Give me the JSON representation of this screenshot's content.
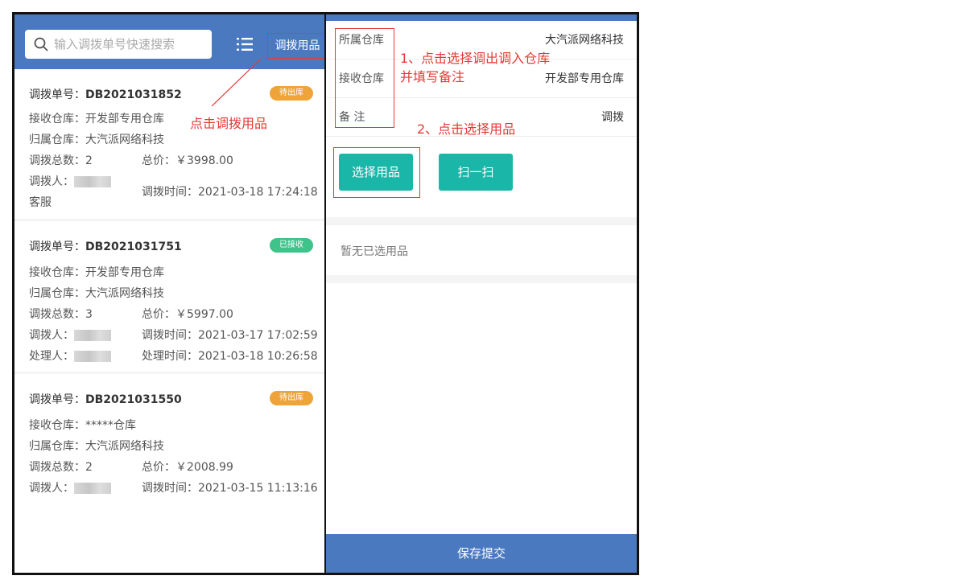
{
  "left": {
    "search_placeholder": "输入调拨单号快速搜索",
    "top_link": "调拨用品",
    "orders": [
      {
        "id_label": "调拨单号：",
        "id": "DB2021031852",
        "status": "待出库",
        "receive": "接收仓库：开发部专用仓库",
        "owner": "归属仓库：大汽派网络科技",
        "count": "调拨总数：2",
        "price": "总价：￥3998.00",
        "person_label": "调拨人：",
        "person_suffix": "客服",
        "time": "调拨时间：2021-03-18 17:24:18"
      },
      {
        "id_label": "调拨单号：",
        "id": "DB2021031751",
        "status": "已接收",
        "receive": "接收仓库：开发部专用仓库",
        "owner": "归属仓库：大汽派网络科技",
        "count": "调拨总数：3",
        "price": "总价：￥5997.00",
        "person_label": "调拨人：",
        "time": "调拨时间：2021-03-17 17:02:59",
        "handler_label": "处理人：",
        "handle_time": "处理时间：2021-03-18 10:26:58"
      },
      {
        "id_label": "调拨单号：",
        "id": "DB2021031550",
        "status": "待出库",
        "receive": "接收仓库：*****仓库",
        "owner": "归属仓库：大汽派网络科技",
        "count": "调拨总数：2",
        "price": "总价：￥2008.99",
        "person_label": "调拨人：",
        "time": "调拨时间：2021-03-15 11:13:16"
      }
    ]
  },
  "right": {
    "form": [
      {
        "label": "所属仓库",
        "value": "大汽派网络科技"
      },
      {
        "label": "接收仓库",
        "value": "开发部专用仓库"
      },
      {
        "label": "备 注",
        "value": "调拨"
      }
    ],
    "select_btn": "选择用品",
    "scan_btn": "扫一扫",
    "empty_text": "暂无已选用品",
    "save_btn": "保存提交"
  },
  "annotations": {
    "left_hint": "点击调拨用品",
    "step1_line1": "1、点击选择调出调入仓库",
    "step1_line2": "并填写备注",
    "step2": "2、点击选择用品"
  },
  "colors": {
    "header_blue": "#4a79bf",
    "teal": "#1ab7a8",
    "badge_orange": "#eea438",
    "badge_green": "#3ec38b",
    "annotation_red": "#e53935"
  }
}
